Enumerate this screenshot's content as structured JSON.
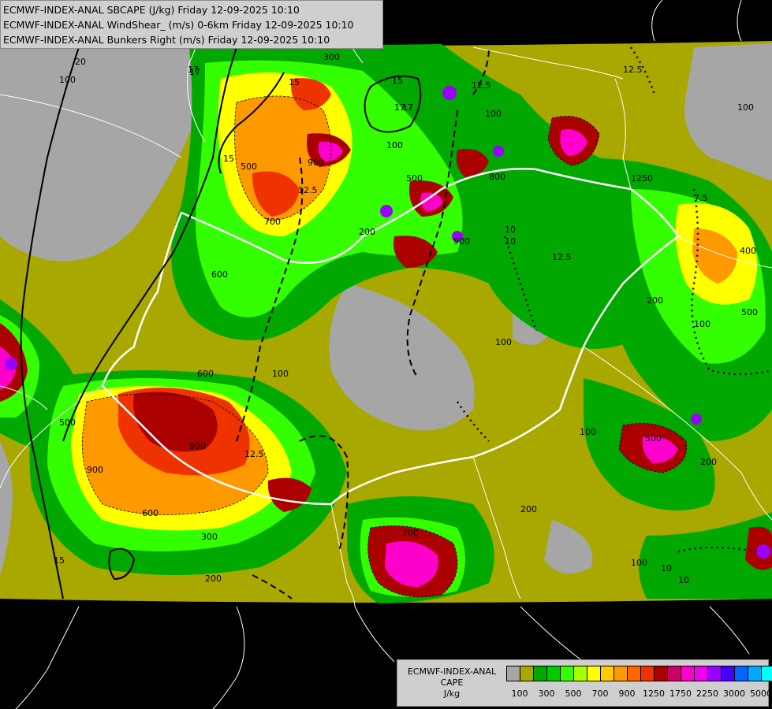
{
  "header": {
    "lines": [
      "ECMWF-INDEX-ANAL SBCAPE (J/kg) Friday 12-09-2025 10:10",
      "ECMWF-INDEX-ANAL WindShear_ (m/s) 0-6km Friday 12-09-2025 10:10",
      "ECMWF-INDEX-ANAL Bunkers Right (m/s) Friday 12-09-2025 10:10"
    ]
  },
  "legend": {
    "title_line1": "ECMWF-INDEX-ANAL",
    "title_line2": "CAPE",
    "unit": "J/kg",
    "colors": [
      "#a6a6a6",
      "#a8a800",
      "#00a800",
      "#00cc00",
      "#33ff00",
      "#aaff00",
      "#ffff00",
      "#ffcc00",
      "#ff9900",
      "#ff6600",
      "#ee3300",
      "#aa0000",
      "#cc0066",
      "#ff00cc",
      "#ee00ee",
      "#9900ff",
      "#4400ff",
      "#0066ff",
      "#00aaff",
      "#00ffff",
      "#aaffff",
      "#ffffff"
    ],
    "ticks": [
      "100",
      "300",
      "500",
      "700",
      "900",
      "1250",
      "1750",
      "2250",
      "3000",
      "5000"
    ]
  },
  "contour_labels": {
    "cape": [
      "300",
      "100",
      "500",
      "900",
      "700",
      "600",
      "100",
      "100",
      "200",
      "800",
      "500",
      "900",
      "600",
      "900",
      "100",
      "300",
      "200",
      "700",
      "600",
      "200",
      "100",
      "100",
      "500",
      "200",
      "100",
      "200",
      "400",
      "500",
      "100",
      "500",
      "900",
      "1250",
      "100"
    ],
    "shear": [
      "20",
      "15",
      "17",
      "15",
      "12.5",
      "12.5",
      "12.5",
      "10",
      "15",
      "10",
      "17",
      "15",
      "12.5",
      "12.5"
    ],
    "bunkers": [
      "17",
      "10",
      "17",
      "10",
      "7.5"
    ]
  }
}
